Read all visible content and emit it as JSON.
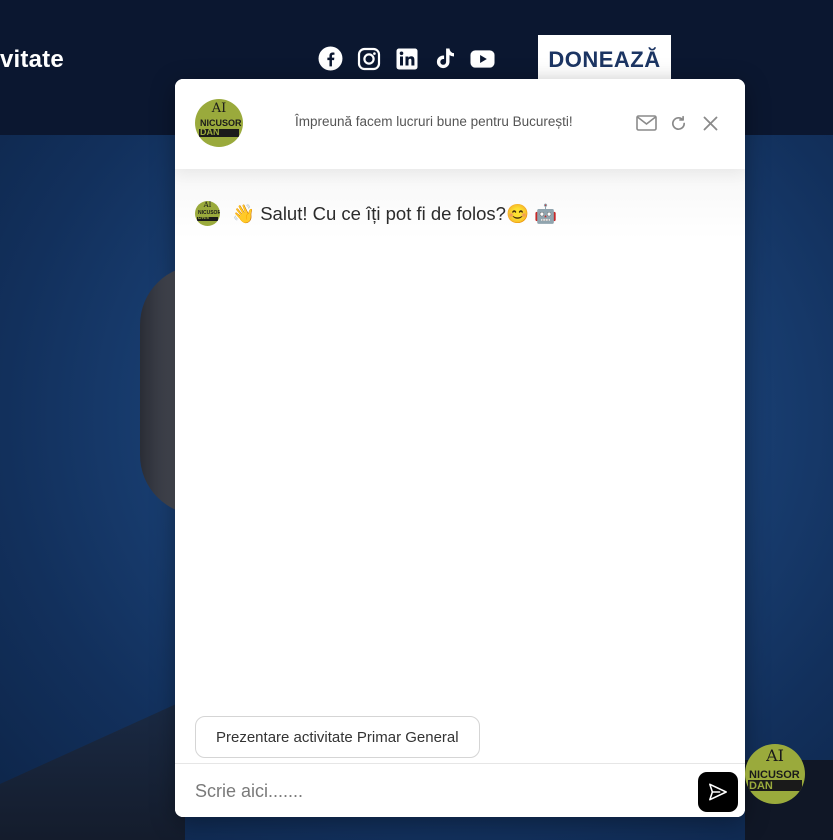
{
  "site": {
    "nav_partial": "vitate",
    "donate_label": "DONEAZĂ",
    "socials": [
      "facebook-icon",
      "instagram-icon",
      "linkedin-icon",
      "tiktok-icon",
      "youtube-icon"
    ]
  },
  "chat": {
    "tagline": "Împreună facem lucruri bune pentru București!",
    "avatar": {
      "ai": "AI",
      "name_line1": "NICUSOR",
      "name_line2": "DAN"
    },
    "header_icons": [
      "mail-icon",
      "refresh-icon",
      "close-icon"
    ],
    "greeting": {
      "wave_emoji": "👋",
      "text": "Salut! Cu ce îți pot fi de folos?",
      "smile_emoji": "😊",
      "robot_emoji": "🤖"
    },
    "suggestion": "Prezentare activitate Primar General",
    "input_placeholder": "Scrie aici.......",
    "send_icon": "send-icon"
  },
  "colors": {
    "avatar_green": "#9aaa3c",
    "navy_bar": "#0b1730",
    "donate_text": "#1c3563"
  }
}
